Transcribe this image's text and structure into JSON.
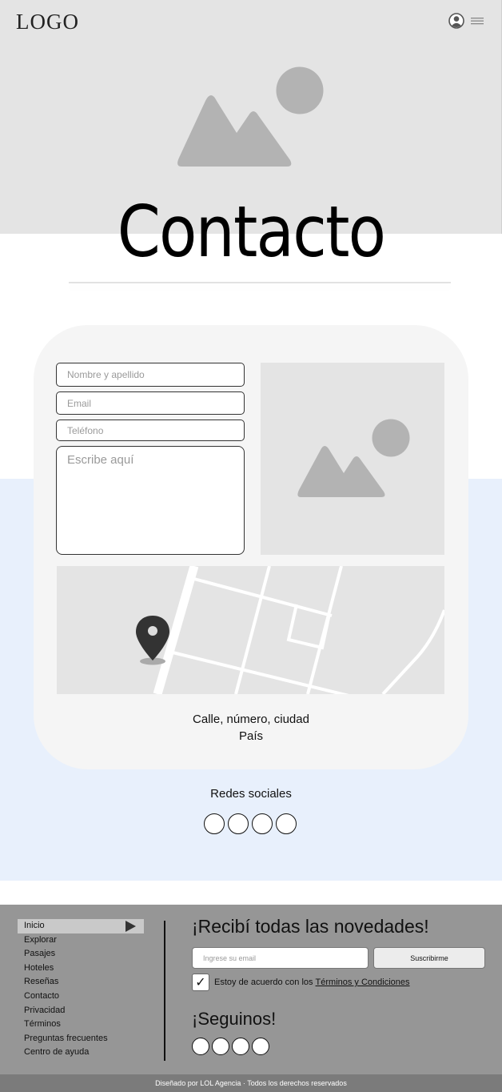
{
  "header": {
    "logo": "LOGO",
    "user_icon": "user-circle-icon",
    "menu_icon": "hamburger-menu-icon"
  },
  "hero": {
    "image_icon": "image-placeholder-icon"
  },
  "page": {
    "title": "Contacto"
  },
  "form": {
    "name_placeholder": "Nombre y apellido",
    "email_placeholder": "Email",
    "phone_placeholder": "Teléfono",
    "message_placeholder": "Escribe aquí"
  },
  "location": {
    "map_icon": "map-pin-icon",
    "address_line1": "Calle, número, ciudad",
    "address_line2": "País"
  },
  "social": {
    "title": "Redes sociales",
    "icons": [
      "social-circle-icon",
      "social-circle-icon",
      "social-circle-icon",
      "social-circle-icon"
    ]
  },
  "footer": {
    "nav": {
      "items": [
        "Inicio",
        "Explorar",
        "Pasajes",
        "Hoteles",
        "Reseñas",
        "Contacto",
        "Privacidad",
        "Términos",
        "Preguntas frecuentes",
        "Centro de ayuda"
      ],
      "active": "Inicio"
    },
    "newsletter": {
      "title": "¡Recibí todas las novedades!",
      "email_placeholder": "Ingrese su email",
      "subscribe_label": "Suscribirme",
      "terms_prefix": "Estoy de acuerdo con los",
      "terms_link": "Términos y Condiciones",
      "terms_checked": true,
      "check_mark": "✓"
    },
    "follow": {
      "title": "¡Seguinos!"
    },
    "copyright": "Diseñado por LOL Agencia · Todos los derechos reservados"
  },
  "colors": {
    "hero_bg": "#e4e4e4",
    "blue_band": "#e8f0fc",
    "card_bg": "#f5f5f5",
    "footer_bg": "#969696",
    "copyright_bg": "#7b7b7b",
    "placeholder_shape": "#b3b3b3"
  }
}
